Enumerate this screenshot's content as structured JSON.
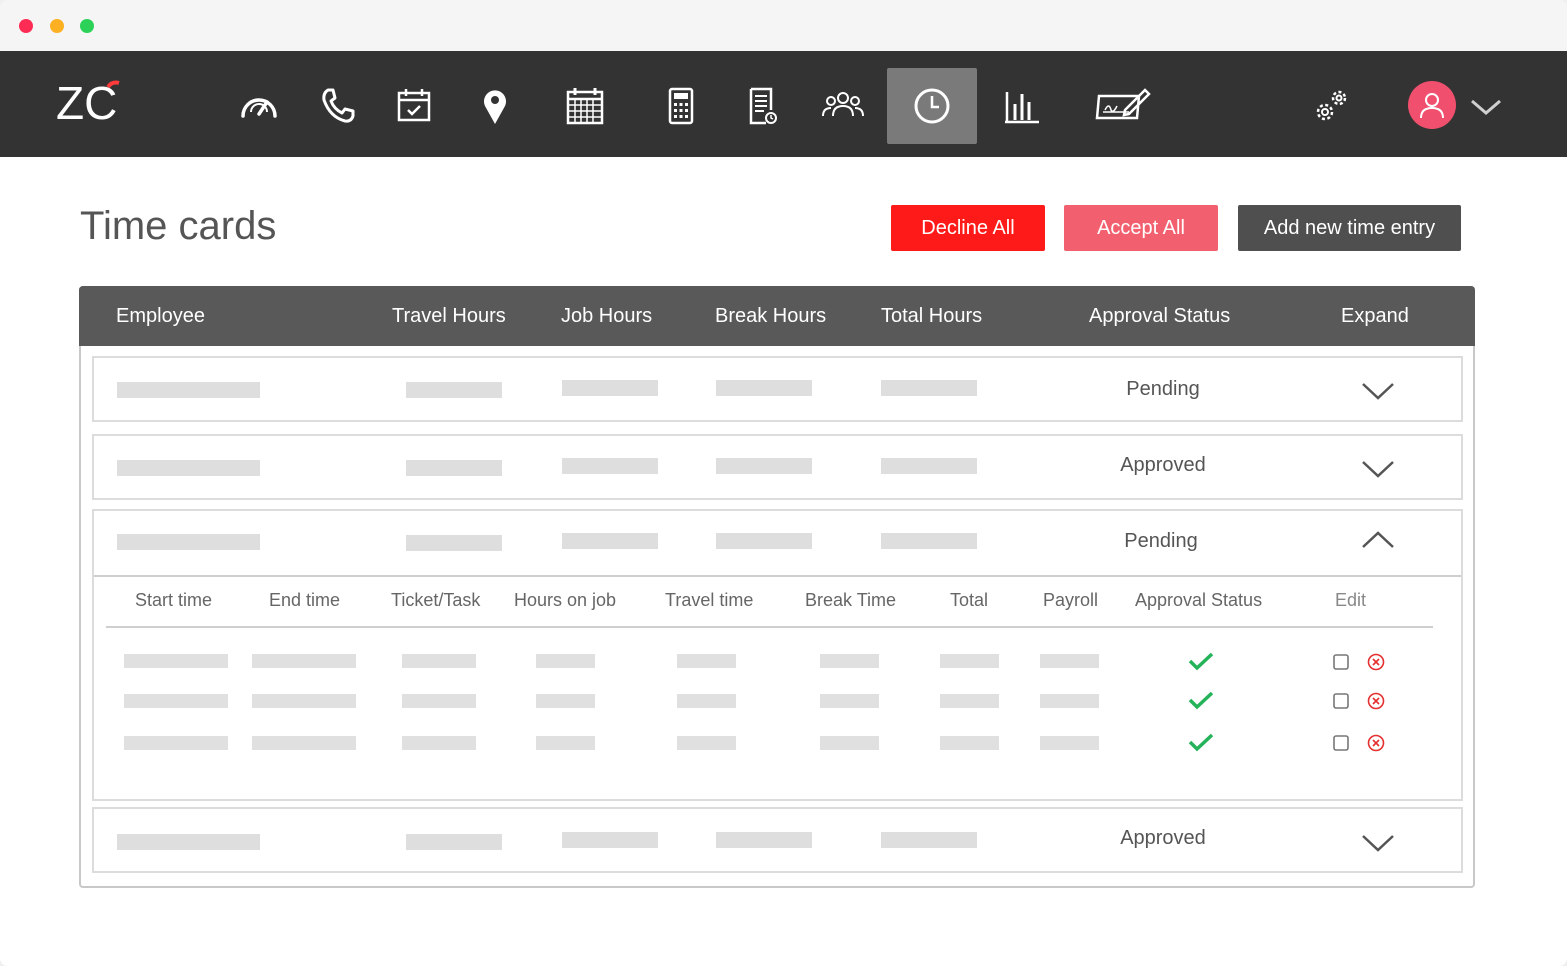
{
  "colors": {
    "navbar_bg": "#333333",
    "active_nav_bg": "#7a7a7a",
    "decline_bg": "#ff1a1a",
    "accept_bg": "#f2606f",
    "addnew_bg": "#4f4f4f",
    "table_header_bg": "#595959",
    "check_green": "#25b35a",
    "cancel_red": "#e53030",
    "avatar_bg": "#f0506e"
  },
  "logo": {
    "text": "ZC"
  },
  "nav": {
    "icons": [
      "speedometer-icon",
      "phone-icon",
      "calendar-check-icon",
      "location-pin-icon",
      "calendar-grid-icon",
      "calculator-icon",
      "invoice-icon",
      "team-icon",
      "clock-icon",
      "bar-chart-icon",
      "signature-icon"
    ],
    "active": "clock-icon",
    "settings_icon": "gears-icon",
    "user_icon": "user-avatar-icon"
  },
  "page": {
    "title": "Time cards",
    "buttons": {
      "decline": "Decline All",
      "accept": "Accept All",
      "add_new": "Add new time entry"
    }
  },
  "table": {
    "headers": {
      "employee": "Employee",
      "travel": "Travel Hours",
      "job": "Job Hours",
      "break": "Break Hours",
      "total": "Total Hours",
      "status": "Approval Status",
      "expand": "Expand"
    },
    "rows": [
      {
        "status": "Pending",
        "expanded": false
      },
      {
        "status": "Approved",
        "expanded": false
      },
      {
        "status": "Pending",
        "expanded": true
      },
      {
        "status": "Approved",
        "expanded": false
      }
    ],
    "detail": {
      "headers": {
        "start": "Start time",
        "end": "End time",
        "ticket": "Ticket/Task",
        "hours_on_job": "Hours on job",
        "travel_time": "Travel time",
        "break_time": "Break Time",
        "total": "Total",
        "payroll": "Payroll",
        "status": "Approval Status",
        "edit": "Edit"
      },
      "entries": [
        {
          "approved": true
        },
        {
          "approved": true
        },
        {
          "approved": true
        }
      ]
    }
  }
}
